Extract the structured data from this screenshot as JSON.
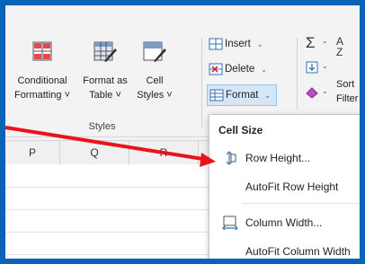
{
  "ribbon": {
    "styles_group": {
      "label": "Styles",
      "conditional_formatting": {
        "line1": "Conditional",
        "line2": "Formatting ˅"
      },
      "format_as_table": {
        "line1": "Format as",
        "line2": "Table ˅"
      },
      "cell_styles": {
        "line1": "Cell",
        "line2": "Styles ˅"
      }
    },
    "cells_group": {
      "insert": "Insert",
      "delete": "Delete",
      "format": "Format"
    },
    "editing_group": {
      "sum_symbol": "Σ",
      "sort_line1": "Sort",
      "sort_line2": "Filter",
      "az_label": "A Z"
    }
  },
  "columns": [
    "P",
    "Q",
    "R"
  ],
  "format_menu": {
    "section_header": "Cell Size",
    "items": [
      {
        "label": "Row Height...",
        "icon": "row-height-icon"
      },
      {
        "label": "AutoFit Row Height",
        "icon": ""
      },
      {
        "label": "Column Width...",
        "icon": "column-width-icon"
      },
      {
        "label": "AutoFit Column Width",
        "icon": ""
      }
    ]
  },
  "colors": {
    "border": "#0a63b8",
    "arrow": "#e8141c",
    "ribbon": "#f3f3f3",
    "format_highlight": "#d5e6f7"
  }
}
